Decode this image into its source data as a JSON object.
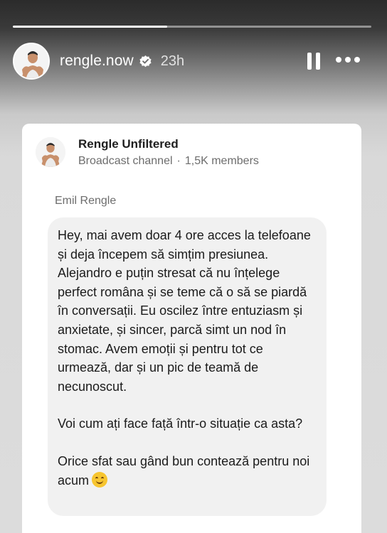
{
  "story": {
    "progress": 0.43,
    "username": "rengle.now",
    "time_ago": "23h",
    "verified_icon": "verified-badge-icon",
    "pause_icon": "pause-icon",
    "more_icon": "more-options-icon"
  },
  "card": {
    "channel_name": "Rengle Unfiltered",
    "channel_type": "Broadcast channel",
    "separator": "·",
    "members": "1,5K members",
    "sender": "Emil Rengle",
    "message": {
      "paragraph1": "Hey, mai avem doar 4 ore acces la telefoane și deja începem să simțim presiunea. Alejandro e puțin stresat că nu înțelege perfect româna și se teme că o să se piardă în conversații. Eu oscilez între entuziasm și anxietate, și sincer, parcă simt un nod în stomac. Avem emoții și pentru tot ce urmează, dar și un pic de teamă de necunoscut.",
      "paragraph2": "Voi cum ați face față într-o situație ca asta?",
      "paragraph3": "Orice sfat sau gând bun contează pentru noi acum",
      "emoji": "smiling-hug-emoji"
    }
  },
  "colors": {
    "accent_white": "#ffffff",
    "bubble_bg": "#f1f1f1",
    "muted_text": "#6d6d6d"
  }
}
